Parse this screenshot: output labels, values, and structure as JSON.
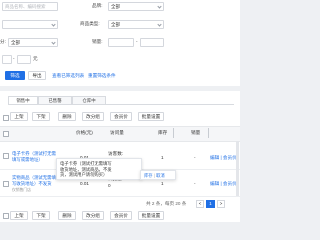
{
  "filters": {
    "keyword_placeholder": "商品名称、编码搜索",
    "brand_label": "品牌:",
    "brand_value": "全部",
    "type_label": "商品类型:",
    "type_value": "全部",
    "category_label": "分:",
    "category_value": "全部",
    "sales_label": "销量:",
    "sales_sep": "-",
    "row5_sep": "-",
    "unit_yuan": "元",
    "search_button": "筛选",
    "export_button": "导出",
    "view_filter_list_link": "查看已筛选列表",
    "reset_link": "重置筛选条件"
  },
  "tabs": [
    {
      "label": "销售中"
    },
    {
      "label": "已售罄"
    },
    {
      "label": "仓库中"
    }
  ],
  "actions": {
    "shelve": "上架",
    "unshelve": "下架",
    "delete": "删除",
    "set_category": "改分组",
    "member_price": "会员价",
    "discount": "批量设置"
  },
  "table": {
    "headers": {
      "price": "价格(元)",
      "visits": "访问量",
      "stock": "库存",
      "sales": "销量",
      "op": "操作"
    },
    "rows": [
      {
        "name": "电子卡券（测试打无需填写或需地址）",
        "price": "0.01",
        "visits_line1": "访客数:",
        "visits_value": "0",
        "stock": "1",
        "sales": "-",
        "ops": "编辑 | 会员价"
      },
      {
        "name": "实物商品（测试无需填写收货地址）不发货",
        "tag": "仅销售门店",
        "price": "0.01",
        "visits_line1": "浏览量:",
        "visits_value": "0",
        "stock": "1",
        "sales": "-",
        "ops": "编辑 | 会员价"
      }
    ]
  },
  "tooltip": {
    "line1": "电子卡券（测试打无需填写",
    "line2": "收货地址，测试商品，不发",
    "line3": "货，测试用户请勿购买）",
    "action1": "库存",
    "action2": "取消"
  },
  "pagination": {
    "summary": "共 2 条，每页 20 条",
    "prev": "<",
    "page": "1",
    "next": ">"
  }
}
